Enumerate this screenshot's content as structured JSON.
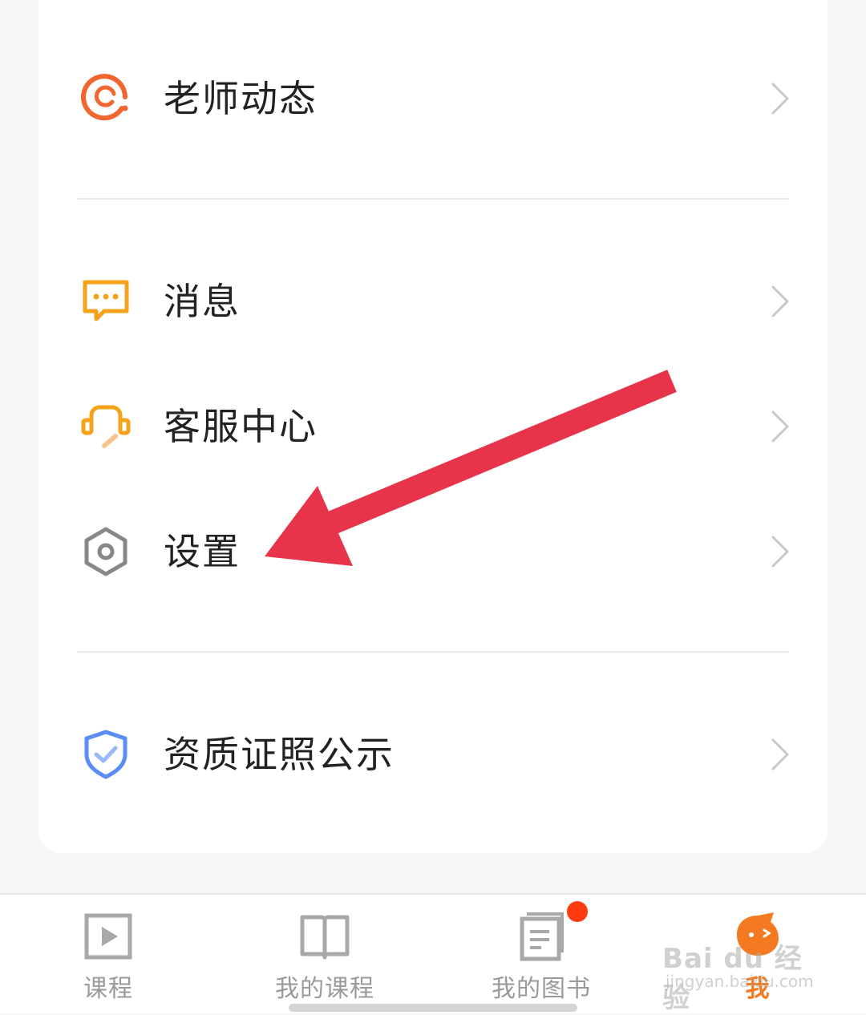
{
  "menu": {
    "teacher_feed": "老师动态",
    "messages": "消息",
    "service_center": "客服中心",
    "settings": "设置",
    "qualifications": "资质证照公示"
  },
  "tabs": [
    {
      "label": "课程",
      "icon": "video-course-icon"
    },
    {
      "label": "我的课程",
      "icon": "open-book-icon"
    },
    {
      "label": "我的图书",
      "icon": "book-icon",
      "badge": true
    },
    {
      "label": "我",
      "icon": "profile-mascot-icon",
      "active": true
    }
  ],
  "watermark": {
    "line1": "Bai du 经验",
    "line2": "jingyan.baidu.com"
  },
  "colors": {
    "accent": "#f47a22",
    "annotation_arrow": "#e8344a",
    "icon_orange": "#f0662e",
    "icon_yellow": "#f5a21b",
    "icon_blue": "#5b8df6",
    "icon_gray": "#888888",
    "badge": "#ff3c10"
  }
}
